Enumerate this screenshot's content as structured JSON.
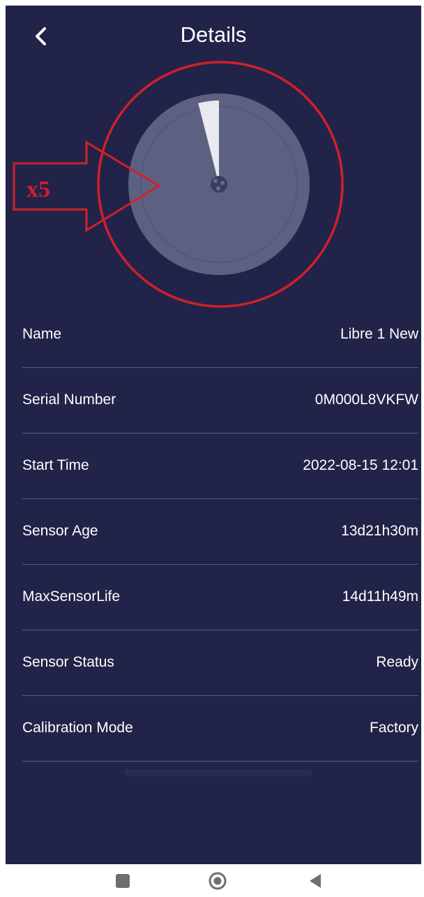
{
  "header": {
    "title": "Details"
  },
  "annotation": {
    "label": "x5"
  },
  "details": [
    {
      "label": "Name",
      "value": "Libre 1 New"
    },
    {
      "label": "Serial Number",
      "value": "0M000L8VKFW"
    },
    {
      "label": "Start Time",
      "value": "2022-08-15 12:01"
    },
    {
      "label": "Sensor Age",
      "value": "13d21h30m"
    },
    {
      "label": "MaxSensorLife",
      "value": "14d11h49m"
    },
    {
      "label": "Sensor Status",
      "value": "Ready"
    },
    {
      "label": "Calibration Mode",
      "value": "Factory"
    }
  ],
  "sensor_life_remaining_fraction": 0.04,
  "colors": {
    "background": "#222348",
    "sensor_disc": "#5d6181",
    "remaining_wedge": "#e9eaef",
    "annotation": "#d0202a",
    "divider": "#595b7d"
  },
  "icons": {
    "back": "chevron-left-icon",
    "nav_recents": "square-icon",
    "nav_home": "circle-icon",
    "nav_back": "triangle-left-icon"
  }
}
